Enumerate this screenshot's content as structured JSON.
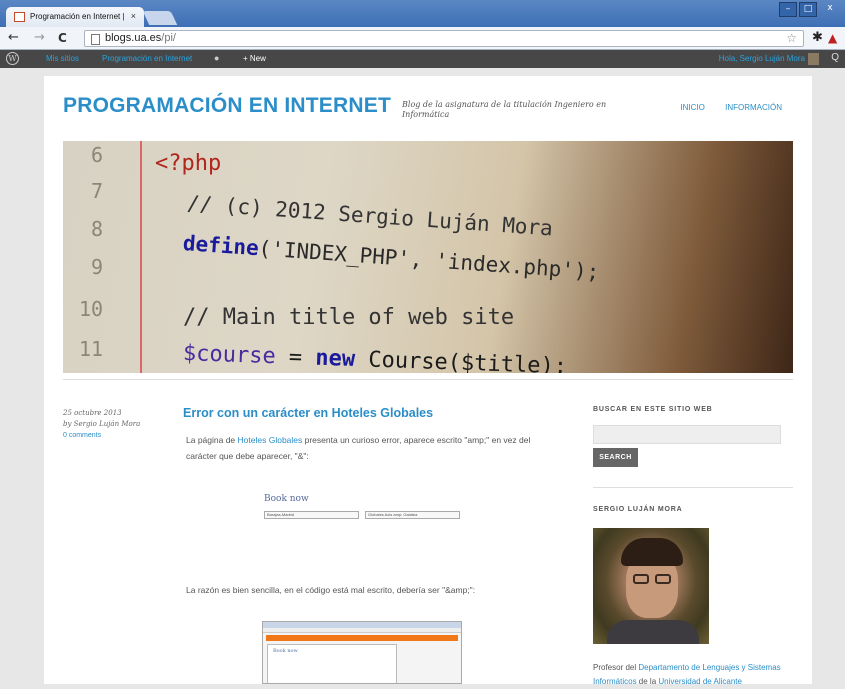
{
  "browser": {
    "tab_title": "Programación en Internet | ",
    "tab_close": "×",
    "url_host": "blogs.ua.es",
    "url_path": "/pi/",
    "back": "←",
    "forward": "→",
    "reload": "C",
    "star": "☆",
    "win_min": "–",
    "win_max": "□",
    "win_close": "x"
  },
  "adminbar": {
    "wp_logo": "W",
    "mis_sitios": "Mis sitios",
    "site_name": "Programación en Internet",
    "comment_icon": "●",
    "new_label": "+ New",
    "hello": "Hola, Sergio Luján Mora",
    "search_icon": "Q"
  },
  "site": {
    "title": "PROGRAMACIÓN EN INTERNET",
    "description": "Blog de la asignatura de la titulación Ingeniero en Informática",
    "nav": [
      "INICIO",
      "INFORMACIÓN"
    ]
  },
  "banner": {
    "line_numbers": [
      "6",
      "7",
      "8",
      "9",
      "10",
      "11"
    ],
    "code": {
      "l6": "<?php",
      "l7": "// (c) 2012 Sergio Luján Mora",
      "l8_fn": "define",
      "l8_args": "('INDEX_PHP', 'index.php');",
      "l10": "// Main title of web site",
      "l11_var": "$course",
      "l11_eq": " = ",
      "l11_new": "new",
      "l11_rest": " Course($title);"
    }
  },
  "post": {
    "date": "25 octubre 2013",
    "author": "by Sergio Luján Mora",
    "comments": "0 comments",
    "title": "Error con un carácter en Hoteles Globales",
    "p1_pre": "La página de ",
    "p1_link": "Hoteles Globales",
    "p1_post": " presenta un curioso error, aparece escrito \"amp;\" en vez del carácter que debe aparecer, \"&\":",
    "img1_heading": "Book now",
    "img1_select1": "Barajas-Madrid",
    "img1_select2": "Globales Acis amp; Galatea",
    "p2": "La razón es bien sencilla, en el código está mal escrito, debería ser \"&amp;\":",
    "img2_heading": "Book now"
  },
  "sidebar": {
    "search_heading": "BUSCAR EN ESTE SITIO WEB",
    "search_value": "",
    "search_button": "SEARCH",
    "author_heading": "SERGIO LUJÁN MORA",
    "bio_pre": "Profesor del ",
    "bio_link1": "Departamento de Lenguajes y Sistemas Informáticos",
    "bio_mid": " de la ",
    "bio_link2": "Universidad de Alicante"
  }
}
